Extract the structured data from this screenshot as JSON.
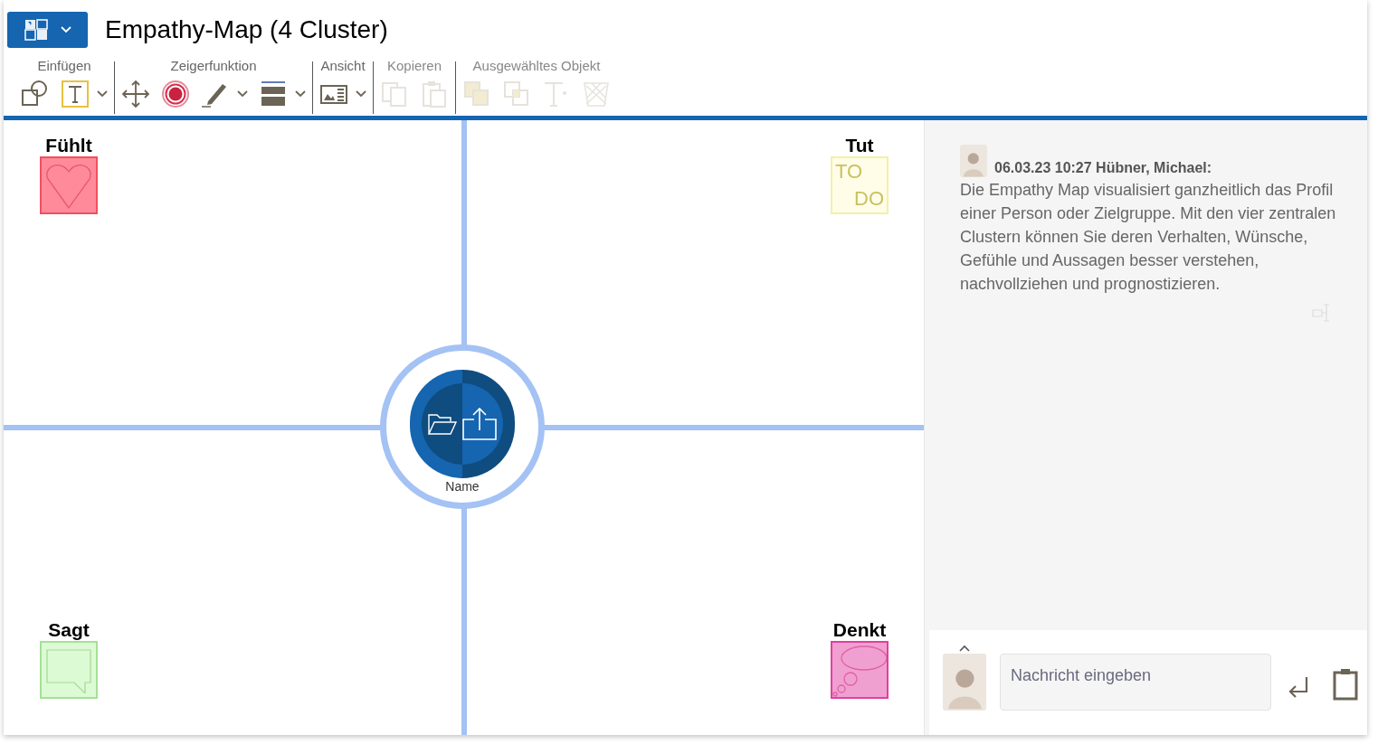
{
  "window": {
    "title": "Empathy-Map (4 Cluster)"
  },
  "toolbar": {
    "groups": [
      {
        "label": "Einfügen",
        "disabled": false,
        "tools": [
          {
            "kind": "shapes",
            "dropdown": false
          },
          {
            "kind": "text",
            "dropdown": true
          }
        ]
      },
      {
        "label": "Zeigerfunktion",
        "disabled": false,
        "tools": [
          {
            "kind": "move",
            "dropdown": false
          },
          {
            "kind": "target",
            "dropdown": false
          },
          {
            "kind": "pen",
            "dropdown": true
          },
          {
            "kind": "line",
            "dropdown": true
          }
        ]
      },
      {
        "label": "Ansicht",
        "disabled": false,
        "tools": [
          {
            "kind": "view",
            "dropdown": true
          }
        ]
      },
      {
        "label": "Kopieren",
        "disabled": true,
        "tools": [
          {
            "kind": "copy",
            "dropdown": false
          },
          {
            "kind": "paste",
            "dropdown": false
          }
        ]
      },
      {
        "label": "Ausgewähltes Objekt",
        "disabled": true,
        "tools": [
          {
            "kind": "front",
            "dropdown": false
          },
          {
            "kind": "back",
            "dropdown": false
          },
          {
            "kind": "textformat",
            "dropdown": false
          },
          {
            "kind": "delete",
            "dropdown": false
          }
        ]
      }
    ]
  },
  "canvas": {
    "clusters": [
      {
        "label": "Fühlt",
        "kind": "heart",
        "color": "#ff8a9a"
      },
      {
        "label": "Tut",
        "kind": "todo",
        "color": "#fffde8",
        "texts": [
          "TO",
          "DO"
        ]
      },
      {
        "label": "Sagt",
        "kind": "speech",
        "color": "#dcfad4"
      },
      {
        "label": "Denkt",
        "kind": "thought",
        "color": "#f0a0d0"
      }
    ],
    "center": {
      "name": "Name"
    }
  },
  "chat": {
    "messages": [
      {
        "header": "06.03.23 10:27 Hübner, Michael:",
        "text": "Die Empathy Map visualisiert ganzheitlich das Profil einer Person oder Zielgruppe. Mit den vier zentralen Clustern können Sie deren Verhalten, Wünsche, Gefühle und Aussagen besser verstehen, nachvollziehen und prognostizieren."
      }
    ],
    "input": {
      "placeholder": "Nachricht eingeben"
    }
  }
}
